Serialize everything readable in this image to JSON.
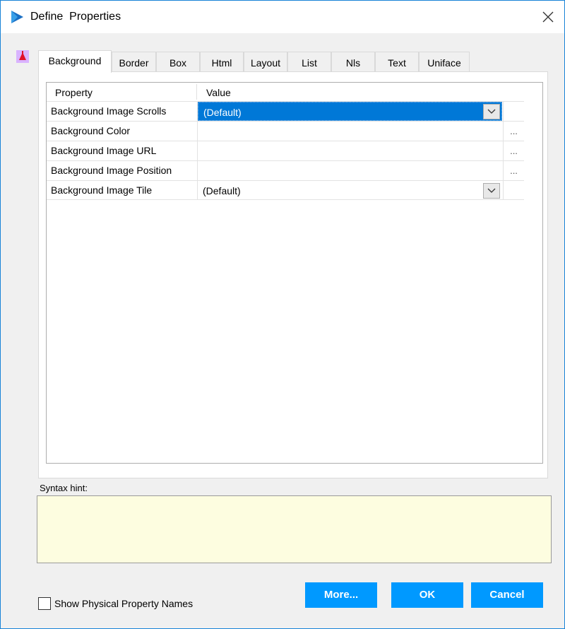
{
  "window": {
    "title": "Define  Properties"
  },
  "tabs": [
    {
      "label": "Background",
      "active": true
    },
    {
      "label": "Border",
      "active": false
    },
    {
      "label": "Box",
      "active": false
    },
    {
      "label": "Html",
      "active": false
    },
    {
      "label": "Layout",
      "active": false
    },
    {
      "label": "List",
      "active": false
    },
    {
      "label": "Nls",
      "active": false
    },
    {
      "label": "Text",
      "active": false
    },
    {
      "label": "Uniface",
      "active": false
    }
  ],
  "grid": {
    "headers": {
      "property": "Property",
      "value": "Value"
    },
    "rows": [
      {
        "property": "Background Image Scrolls",
        "value": "(Default)",
        "control": "dropdown",
        "selected": true
      },
      {
        "property": "Background Color",
        "value": "",
        "control": "ellipsis"
      },
      {
        "property": "Background Image URL",
        "value": "",
        "control": "ellipsis"
      },
      {
        "property": "Background Image Position",
        "value": "",
        "control": "ellipsis"
      },
      {
        "property": "Background Image Tile",
        "value": "(Default)",
        "control": "dropdown",
        "selected": false
      }
    ],
    "ellipsis_label": "..."
  },
  "syntax_hint": {
    "label": "Syntax hint:",
    "value": ""
  },
  "show_physical": {
    "label": "Show Physical Property Names",
    "checked": false
  },
  "buttons": {
    "more": "More...",
    "ok": "OK",
    "cancel": "Cancel"
  },
  "colors": {
    "accent": "#0099ff",
    "selection": "#0078d7",
    "hint_bg": "#fdfde0"
  }
}
